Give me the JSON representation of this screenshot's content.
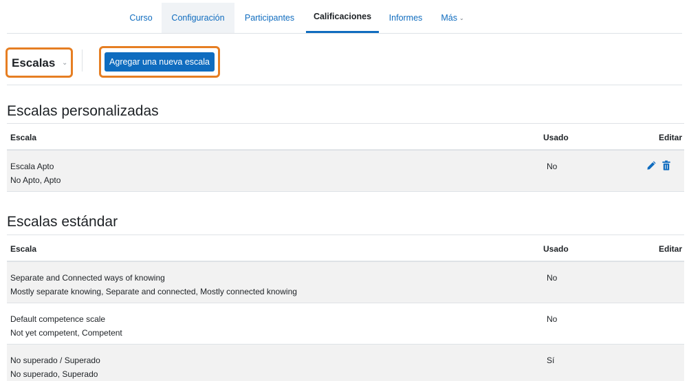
{
  "nav": {
    "tabs": [
      {
        "label": "Curso"
      },
      {
        "label": "Configuración"
      },
      {
        "label": "Participantes"
      },
      {
        "label": "Calificaciones"
      },
      {
        "label": "Informes"
      },
      {
        "label": "Más"
      }
    ],
    "active_tab": "Calificaciones"
  },
  "action_bar": {
    "selector_label": "Escalas",
    "add_button_label": "Agregar una nueva escala"
  },
  "custom_scales": {
    "title": "Escalas personalizadas",
    "headers": {
      "name": "Escala",
      "used": "Usado",
      "edit": "Editar"
    },
    "rows": [
      {
        "name": "Escala Apto",
        "items": "No Apto, Apto",
        "used": "No",
        "editable": true
      }
    ]
  },
  "standard_scales": {
    "title": "Escalas estándar",
    "headers": {
      "name": "Escala",
      "used": "Usado",
      "edit": "Editar"
    },
    "rows": [
      {
        "name": "Separate and Connected ways of knowing",
        "items": "Mostly separate knowing, Separate and connected, Mostly connected knowing",
        "used": "No"
      },
      {
        "name": "Default competence scale",
        "items": "Not yet competent, Competent",
        "used": "No"
      },
      {
        "name": "No superado / Superado",
        "items": "No superado, Superado",
        "used": "Sí"
      }
    ]
  },
  "colors": {
    "link": "#0f6cbf",
    "primary_button": "#0f6cbf",
    "highlight_outline": "#e67e22",
    "row_shade": "#f2f2f2"
  },
  "icons": {
    "edit": "pencil-icon",
    "delete": "trash-icon",
    "dropdown": "chevron-down-icon"
  }
}
